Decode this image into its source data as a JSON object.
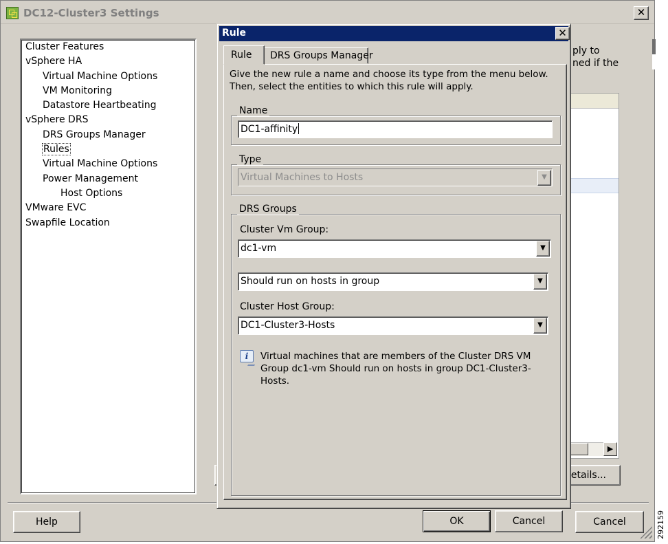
{
  "outer_window": {
    "title": "DC12-Cluster3 Settings",
    "close_glyph": "✕",
    "tree": [
      {
        "label": "Cluster Features",
        "level": 0
      },
      {
        "label": "vSphere HA",
        "level": 0
      },
      {
        "label": "Virtual Machine Options",
        "level": 1
      },
      {
        "label": "VM Monitoring",
        "level": 1
      },
      {
        "label": "Datastore Heartbeating",
        "level": 1
      },
      {
        "label": "vSphere DRS",
        "level": 0
      },
      {
        "label": "DRS Groups Manager",
        "level": 1
      },
      {
        "label": "Rules",
        "level": 1,
        "selected": true
      },
      {
        "label": "Virtual Machine Options",
        "level": 1
      },
      {
        "label": "Power Management",
        "level": 1
      },
      {
        "label": "Host Options",
        "level": 2
      },
      {
        "label": "VMware EVC",
        "level": 0
      },
      {
        "label": "Swapfile Location",
        "level": 0
      }
    ],
    "background_text_1": "ply to",
    "background_text_2": "ned if the",
    "details_label": "etails...",
    "help_label": "Help",
    "cancel_label": "Cancel",
    "figure_id": "292159"
  },
  "rule_dialog": {
    "title": "Rule",
    "close_glyph": "✕",
    "tabs": [
      {
        "label": "Rule",
        "active": true
      },
      {
        "label": "DRS Groups Manager",
        "active": false
      }
    ],
    "intro_text": "Give the new rule a name and choose its type from the menu below. Then, select the entities to which this rule will apply.",
    "name_group_label": "Name",
    "name_value": "DC1-affinity",
    "type_group_label": "Type",
    "type_value": "Virtual Machines to Hosts",
    "drs_group_label": "DRS Groups",
    "vm_group_label": "Cluster Vm Group:",
    "vm_group_value": "dc1-vm",
    "relation_value": "Should run on hosts in group",
    "host_group_label": "Cluster Host Group:",
    "host_group_value": "DC1-Cluster3-Hosts",
    "info_text": "Virtual machines that are members of the Cluster DRS VM Group dc1-vm Should run on hosts in group DC1-Cluster3-Hosts.",
    "ok_label": "OK",
    "cancel_label": "Cancel",
    "dropdown_glyph": "▼"
  }
}
